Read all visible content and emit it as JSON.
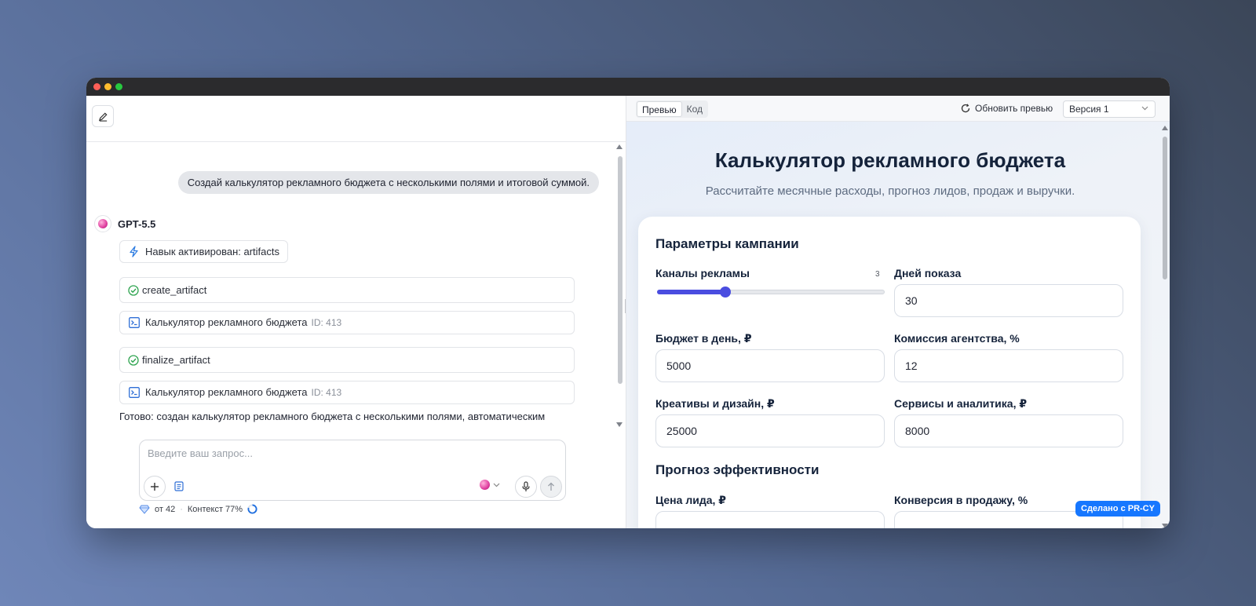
{
  "chat": {
    "user_message": "Создай калькулятор рекламного бюджета с несколькими полями и итоговой суммой.",
    "model_name": "GPT-5.5",
    "skill_label": "Навык активирован: artifacts",
    "tool1_name": "create_artifact",
    "tool2_name": "finalize_artifact",
    "artifact_title": "Калькулятор рекламного бюджета",
    "artifact_id": "ID: 413",
    "final_text": "Готово: создан калькулятор рекламного бюджета с несколькими полями, автоматическим"
  },
  "composer": {
    "placeholder": "Введите ваш запрос...",
    "credits": "от 42",
    "context": "Контекст 77%"
  },
  "preview": {
    "tabs": [
      "Превью",
      "Код"
    ],
    "active_tab": "Превью",
    "refresh_label": "Обновить превью",
    "version": "Версия 1",
    "badge": "Сделано с PR-CY"
  },
  "calculator": {
    "title": "Калькулятор рекламного бюджета",
    "subtitle": "Рассчитайте месячные расходы, прогноз лидов, продаж и выручки.",
    "section1": "Параметры кампании",
    "section2": "Прогноз эффективности",
    "channels": {
      "label": "Каналы рекламы",
      "value": 3,
      "fraction": 0.3
    },
    "days": {
      "label": "Дней показа",
      "value": "30"
    },
    "daily_budget": {
      "label": "Бюджет в день, ₽",
      "value": "5000"
    },
    "agency_fee": {
      "label": "Комиссия агентства, %",
      "value": "12"
    },
    "creatives": {
      "label": "Креативы и дизайн, ₽",
      "value": "25000"
    },
    "services": {
      "label": "Сервисы и аналитика, ₽",
      "value": "8000"
    },
    "lead_price": {
      "label": "Цена лида, ₽"
    },
    "conversion": {
      "label": "Конверсия в продажу, %"
    }
  },
  "colors": {
    "accent": "#4a4de0",
    "badge": "#1677ff",
    "title": "#15233b"
  }
}
